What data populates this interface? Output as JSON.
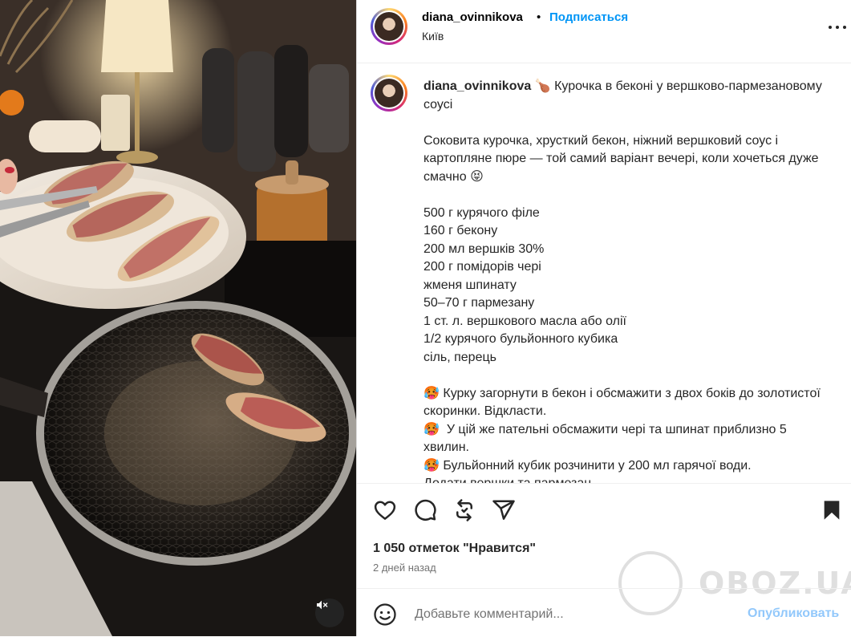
{
  "post": {
    "username": "diana_ovinnikova",
    "separator": "•",
    "follow_label": "Подписаться",
    "location": "Київ",
    "more_icon": "more-horizontal-icon"
  },
  "caption": {
    "username": "diana_ovinnikova",
    "text": " 🍗 Курочка в беконі у вершково-пармезановому соусі\n\nСоковита курочка, хрусткий бекон, ніжний вершковий соус і картопляне пюре — той самий варіант вечері, коли хочеться дуже смачно 😝\n\n500 г курячого філе\n160 г бекону\n200 мл вершків 30%\n200 г помідорів чері\nжменя шпинату\n50–70 г пармезану\n1 ст. л. вершкового масла або олії\n1/2 курячого бульйонного кубика\nсіль, перець\n\n🥵 Курку загорнути в бекон і обсмажити з двох боків до золотистої скоринки. Відкласти.\n🥵  У цій же пательні обсмажити чері та шпинат приблизно 5 хвилин.\n🥵 Бульйонний кубик розчинити у 200 мл гарячої води.\nДодати вершки та пармезан."
  },
  "actions": {
    "like_icon": "heart-icon",
    "comment_icon": "comment-icon",
    "repost_icon": "repost-icon",
    "share_icon": "share-icon",
    "save_icon": "bookmark-icon"
  },
  "likes_text": "1 050 отметок \"Нравится\"",
  "date_text": "2 дней назад",
  "watermark": "OBOZ.UA",
  "comment": {
    "emoji_icon": "smiley-icon",
    "placeholder": "Добавьте комментарий...",
    "publish_label": "Опубликовать"
  },
  "media": {
    "mute_icon": "speaker-muted-icon"
  },
  "colors": {
    "accent": "#0095f6",
    "publish_disabled": "#92c8fb",
    "text": "#262626",
    "muted": "#737373"
  }
}
